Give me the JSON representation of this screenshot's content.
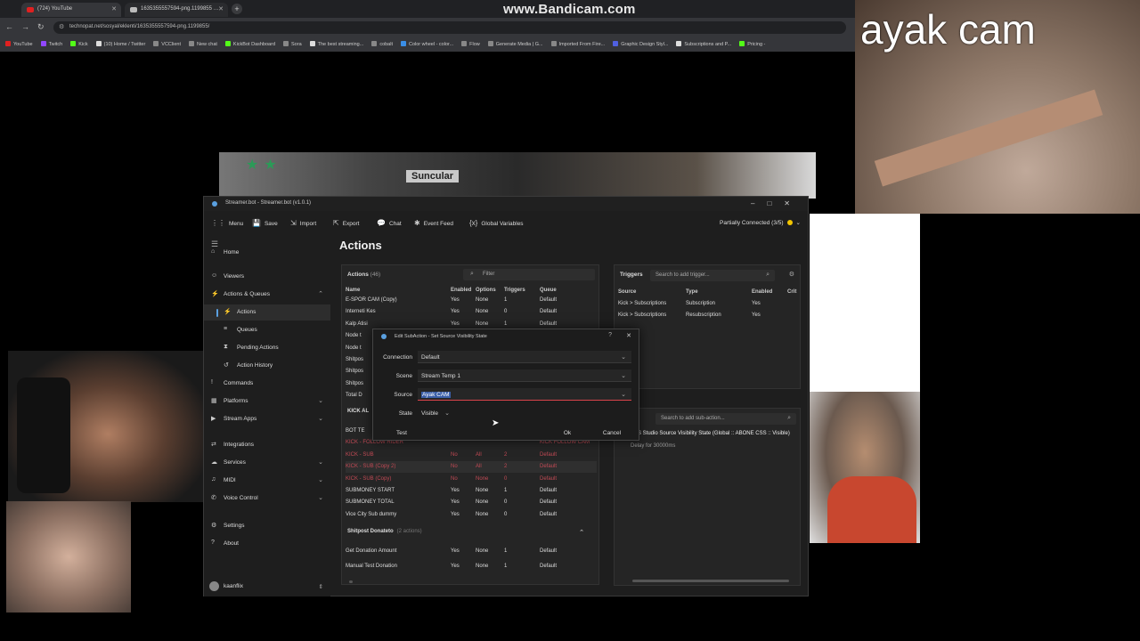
{
  "browser": {
    "tabs": [
      {
        "label": "(724) YouTube",
        "color": "#e02020"
      },
      {
        "label": "1635355557594-png.1199855 …",
        "color": "#bbbbbb"
      }
    ],
    "url": "technopat.net/sosyal/eklenti/1635355557594-png.1199855/",
    "bookmarks": [
      {
        "label": "YouTube",
        "color": "#e02020"
      },
      {
        "label": "Twitch",
        "color": "#9147ff"
      },
      {
        "label": "Kick",
        "color": "#53fc18"
      },
      {
        "label": "(10) Home / Twitter",
        "color": "#dddddd"
      },
      {
        "label": "VCClient",
        "color": "#888888"
      },
      {
        "label": "New chat",
        "color": "#888888"
      },
      {
        "label": "KickBot Dashboard",
        "color": "#53fc18"
      },
      {
        "label": "Sora",
        "color": "#888888"
      },
      {
        "label": "The best streaming...",
        "color": "#dddddd"
      },
      {
        "label": "cobalt",
        "color": "#888888"
      },
      {
        "label": "Color wheel - color...",
        "color": "#3a8ee6"
      },
      {
        "label": "Flow",
        "color": "#888888"
      },
      {
        "label": "Generate Media | G...",
        "color": "#888888"
      },
      {
        "label": "Imported From Fire...",
        "color": "#888888"
      },
      {
        "label": "Graphic Design Styl...",
        "color": "#5060e0"
      },
      {
        "label": "Subscriptions and P...",
        "color": "#dddddd"
      },
      {
        "label": "Pricing -",
        "color": "#53fc18"
      }
    ]
  },
  "watermark": "www.Bandicam.com",
  "background": {
    "banner_text": "Suncular"
  },
  "camera": {
    "label": "ayak cam"
  },
  "window": {
    "title": "Streamer.bot - Streamer.bot (v1.0.1)",
    "menu": [
      {
        "label": "Menu",
        "icon": "grid-icon"
      },
      {
        "label": "Save",
        "icon": "save-icon"
      },
      {
        "label": "Import",
        "icon": "import-icon"
      },
      {
        "label": "Export",
        "icon": "export-icon"
      },
      {
        "label": "Chat",
        "icon": "chat-icon"
      },
      {
        "label": "Event Feed",
        "icon": "feed-icon"
      },
      {
        "label": "Global Variables",
        "icon": "variables-icon"
      }
    ],
    "connection": "Partially Connected (3/5)",
    "connection_color": "#f2c500"
  },
  "sidebar": {
    "items": [
      {
        "label": "Home",
        "icon": "home-icon",
        "sub": false
      },
      {
        "label": "Viewers",
        "icon": "viewers-icon",
        "sub": false
      },
      {
        "label": "Actions & Queues",
        "icon": "actions-icon",
        "sub": false,
        "expanded": true
      },
      {
        "label": "Actions",
        "icon": "actions-icon",
        "sub": true,
        "selected": true
      },
      {
        "label": "Queues",
        "icon": "queues-icon",
        "sub": true
      },
      {
        "label": "Pending Actions",
        "icon": "pending-icon",
        "sub": true
      },
      {
        "label": "Action History",
        "icon": "history-icon",
        "sub": true
      },
      {
        "label": "Commands",
        "icon": "commands-icon",
        "sub": false
      },
      {
        "label": "Platforms",
        "icon": "platforms-icon",
        "sub": false,
        "collapsible": true
      },
      {
        "label": "Stream Apps",
        "icon": "apps-icon",
        "sub": false,
        "collapsible": true
      },
      {
        "label": "Integrations",
        "icon": "integrations-icon",
        "sub": false
      },
      {
        "label": "Services",
        "icon": "services-icon",
        "sub": false,
        "collapsible": true
      },
      {
        "label": "MIDI",
        "icon": "midi-icon",
        "sub": false,
        "collapsible": true
      },
      {
        "label": "Voice Control",
        "icon": "voice-icon",
        "sub": false,
        "collapsible": true
      },
      {
        "label": "Settings",
        "icon": "settings-icon",
        "sub": false
      },
      {
        "label": "About",
        "icon": "about-icon",
        "sub": false
      }
    ],
    "user": "kaanflix"
  },
  "main": {
    "title": "Actions",
    "actions_panel": {
      "title": "Actions",
      "count": "(46)",
      "filter_placeholder": "Filter",
      "columns": [
        "Name",
        "Enabled",
        "Options",
        "Triggers",
        "Queue"
      ],
      "rows": [
        {
          "name": "E-SPOR CAM (Copy)",
          "enabled": "Yes",
          "options": "None",
          "triggers": "1",
          "queue": "Default"
        },
        {
          "name": "Interneti Kes",
          "enabled": "Yes",
          "options": "None",
          "triggers": "0",
          "queue": "Default"
        },
        {
          "name": "Kalp Atisi",
          "enabled": "Yes",
          "options": "None",
          "triggers": "1",
          "queue": "Default"
        },
        {
          "name": "Node t",
          "enabled": "",
          "options": "",
          "triggers": "",
          "queue": ""
        },
        {
          "name": "Node t",
          "enabled": "",
          "options": "",
          "triggers": "",
          "queue": ""
        },
        {
          "name": "Shitpos",
          "enabled": "",
          "options": "",
          "triggers": "",
          "queue": ""
        },
        {
          "name": "Shitpos",
          "enabled": "",
          "options": "",
          "triggers": "",
          "queue": ""
        },
        {
          "name": "Shitpos",
          "enabled": "",
          "options": "",
          "triggers": "",
          "queue": ""
        },
        {
          "name": "Total D",
          "enabled": "",
          "options": "",
          "triggers": "",
          "queue": ""
        }
      ],
      "group_kick": "KICK AL",
      "kick_rows": [
        {
          "name": "BOT TE",
          "enabled": "",
          "options": "",
          "triggers": "",
          "queue": "",
          "disabled": false
        },
        {
          "name": "KICK - FOLLOW RIDER",
          "enabled": "",
          "options": "",
          "triggers": "",
          "queue": "KICK FOLLOW CAM",
          "disabled": true
        },
        {
          "name": "KICK - SUB",
          "enabled": "No",
          "options": "All",
          "triggers": "2",
          "queue": "Default",
          "disabled": true
        },
        {
          "name": "KICK - SUB (Copy 2)",
          "enabled": "No",
          "options": "All",
          "triggers": "2",
          "queue": "Default",
          "disabled": true,
          "selected": true
        },
        {
          "name": "KICK - SUB (Copy)",
          "enabled": "No",
          "options": "None",
          "triggers": "0",
          "queue": "Default",
          "disabled": true
        },
        {
          "name": "SUBMONEY START",
          "enabled": "Yes",
          "options": "None",
          "triggers": "1",
          "queue": "Default",
          "disabled": false
        },
        {
          "name": "SUBMONEY TOTAL",
          "enabled": "Yes",
          "options": "None",
          "triggers": "0",
          "queue": "Default",
          "disabled": false
        },
        {
          "name": "Vice City Sub dummy",
          "enabled": "Yes",
          "options": "None",
          "triggers": "0",
          "queue": "Default",
          "disabled": false
        }
      ],
      "group_shitpost": "Shitpost Donateto",
      "group_shitpost_count": "(2 actions)",
      "shitpost_rows": [
        {
          "name": "Get Donation Amount",
          "enabled": "Yes",
          "options": "None",
          "triggers": "1",
          "queue": "Default"
        },
        {
          "name": "Manual Test Donation",
          "enabled": "Yes",
          "options": "None",
          "triggers": "1",
          "queue": "Default"
        }
      ]
    },
    "triggers_panel": {
      "title": "Triggers",
      "search_placeholder": "Search to add trigger...",
      "columns": [
        "Source",
        "Type",
        "Enabled",
        "Crit"
      ],
      "rows": [
        {
          "source": "Kick > Subscriptions",
          "type": "Subscription",
          "enabled": "Yes"
        },
        {
          "source": "Kick > Subscriptions",
          "type": "Resubscription",
          "enabled": "Yes"
        }
      ]
    },
    "subactions_panel": {
      "title": "ons",
      "search_placeholder": "Search to add sub-action...",
      "items": [
        "S Studio Source Visibility State (Global :: ABONE CSS :: Visible)",
        "Delay for 30000ms"
      ]
    }
  },
  "dialog": {
    "title": "Edit SubAction - Set Source Visibility State",
    "fields": [
      {
        "label": "Connection",
        "value": "Default"
      },
      {
        "label": "Scene",
        "value": "Stream Temp 1"
      },
      {
        "label": "Source",
        "value": "Ayak CAM"
      },
      {
        "label": "State",
        "value": "Visible"
      }
    ],
    "test_label": "Test",
    "ok_label": "Ok",
    "cancel_label": "Cancel"
  }
}
